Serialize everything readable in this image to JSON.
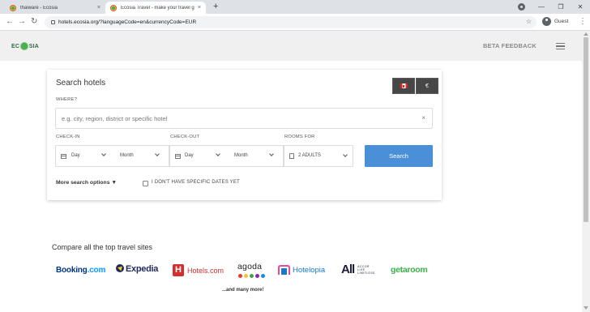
{
  "browser": {
    "tabs": [
      {
        "title": "thaiware - Ecosia",
        "close": "×"
      },
      {
        "title": "Ecosia Travel - make your travel greener",
        "close": "×"
      }
    ],
    "new_tab": "+",
    "window_controls": {
      "minimize": "—",
      "restore": "❐",
      "close": "✕"
    },
    "nav": {
      "back": "←",
      "forward": "→",
      "reload": "↻"
    },
    "url": "hotels.ecosia.org/?languageCode=en&currencyCode=EUR",
    "profile_label": "Guest",
    "menu": "⋮"
  },
  "site": {
    "logo_text_left": "EC",
    "logo_text_right": "SIA",
    "beta_feedback": "BETA FEEDBACK"
  },
  "search": {
    "title": "Search hotels",
    "currency_symbol": "€",
    "where_label": "WHERE?",
    "where_placeholder": "e.g. city, region, district or specific hotel",
    "clear_icon": "×",
    "checkin_label": "CHECK-IN",
    "checkout_label": "CHECK-OUT",
    "rooms_label": "ROOMS FOR",
    "checkin_day": "Day",
    "checkin_month": "Month",
    "checkout_day": "Day",
    "checkout_month": "Month",
    "rooms_value": "2 ADULTS",
    "search_button": "Search",
    "more_options": "More search options ▼",
    "no_dates": "I DON'T HAVE SPECIFIC DATES YET"
  },
  "compare": {
    "title": "Compare all the top travel sites",
    "brands": {
      "booking": "Booking",
      "booking_dotcom": ".com",
      "expedia": "Expedia",
      "hotels_icon": "H",
      "hotels": "Hotels.com",
      "agoda": "agoda",
      "hotelopia": "Hotelopia",
      "accor": "All",
      "accor_small": "ACCOR LIVE LIMITLESS",
      "getaroom": "getaroom"
    },
    "more": "...and many more!"
  },
  "colors": {
    "accent": "#4a90d9",
    "header_bg": "#f0f0f0",
    "agoda_dots": [
      "#e53935",
      "#fbc02d",
      "#43a047",
      "#8e24aa",
      "#1e88e5"
    ]
  }
}
